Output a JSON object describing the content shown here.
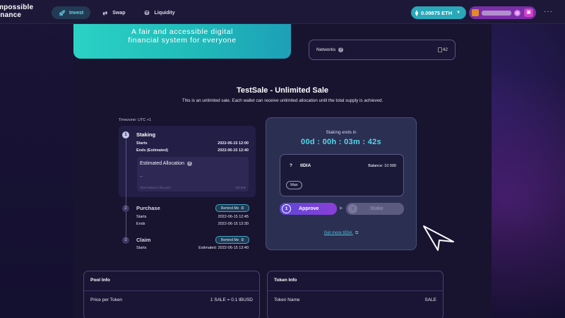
{
  "header": {
    "logo_line1": "Impossible",
    "logo_line2": "Finance",
    "nav": [
      {
        "label": "Invest",
        "icon": "rocket-icon"
      },
      {
        "label": "Swap",
        "icon": "swap-icon"
      },
      {
        "label": "Liquidity",
        "icon": "liquidity-icon"
      }
    ],
    "eth_balance": "0.09875 ETH",
    "more": "···"
  },
  "banner": {
    "line1": "A fair and accessible digital",
    "line2": "financial system for everyone"
  },
  "networks": {
    "label": "Networks",
    "img_alt": "42"
  },
  "sale": {
    "title": "TestSale - Unlimited Sale",
    "description": "This is an unlimited sale. Each wallet can receive unlimited allocation until the total supply is achieved.",
    "timezone": "Timezone: UTC +1"
  },
  "timeline": {
    "staking": {
      "num": "1",
      "title": "Staking",
      "starts_label": "Starts",
      "starts_value": "2022-06-15 12:00",
      "ends_label": "Ends (Estimated)",
      "ends_value": "2022-06-15 12:40",
      "alloc_title": "Estimated Allocation",
      "alloc_value": "--",
      "alloc_foot_label": "Total staked in this pool",
      "alloc_foot_value": "100.000"
    },
    "purchase": {
      "num": "2",
      "title": "Purchase",
      "remind": "Remind Me",
      "starts_label": "Starts",
      "starts_value": "2022-06-15 12:45",
      "ends_label": "Ends",
      "ends_value": "2022-06-15 13:30"
    },
    "claim": {
      "num": "3",
      "title": "Claim",
      "remind": "Remind Me",
      "starts_label": "Starts",
      "starts_value": "Estimated: 2022-06-15 13:40"
    }
  },
  "stake_card": {
    "ends_label": "Staking ends in",
    "countdown": "00d : 00h : 03m : 42s",
    "token_symbol_icon": "?",
    "token_name": "tIDIA",
    "balance": "Balance: 10 000",
    "max": "Max",
    "approve_num": "1",
    "approve": "Approve",
    "stake_num": "2",
    "stake": "Stake",
    "get_more": "Get more tIDIA"
  },
  "pool_info": {
    "title": "Pool Info",
    "row_label": "Price per Token",
    "row_value": "1 SALE = 0.1 tBUSD"
  },
  "token_info": {
    "title": "Token Info",
    "row_label": "Token Name",
    "row_value": "SALE"
  },
  "colors": {
    "accent_cyan": "#56d8ea",
    "approve_purple": "#7a42d8",
    "wallet_purple": "#7a2ea8"
  }
}
